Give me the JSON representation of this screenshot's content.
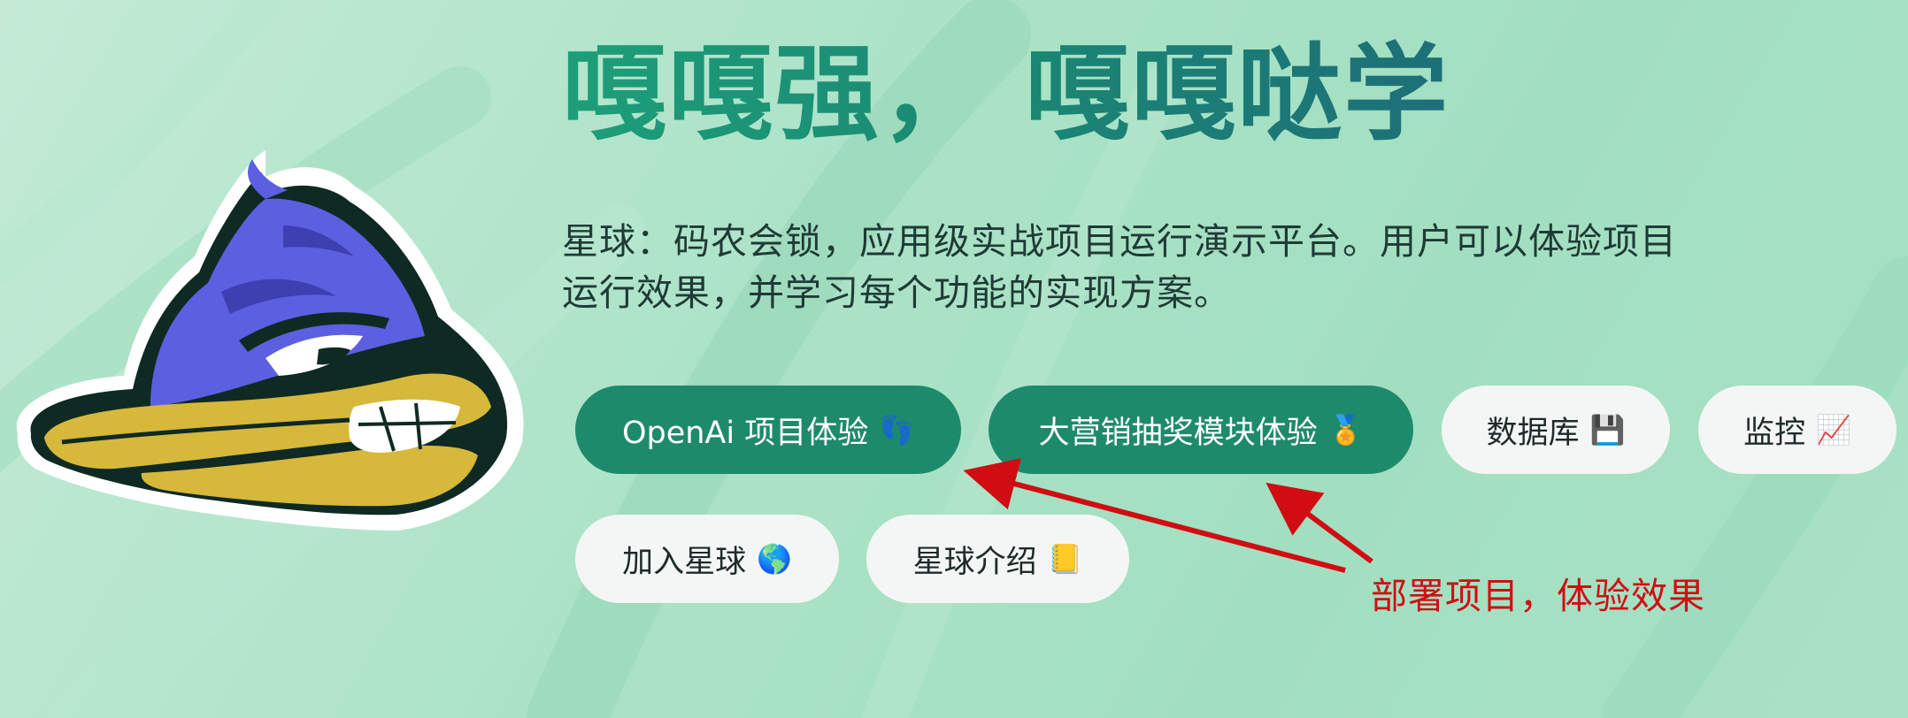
{
  "hero": {
    "title": "嘎嘎强， 嘎嘎哒学",
    "description": "星球：码农会锁，应用级实战项目运行演示平台。用户可以体验项目运行效果，并学习每个功能的实现方案。"
  },
  "buttons": [
    {
      "label": "OpenAi 项目体验",
      "icon": "👣",
      "icon_name": "footprints-icon",
      "style": "primary"
    },
    {
      "label": "大营销抽奖模块体验",
      "icon": "🏅",
      "icon_name": "medal-icon",
      "style": "primary"
    },
    {
      "label": "数据库",
      "icon": "💾",
      "icon_name": "floppy-disk-icon",
      "style": "light"
    },
    {
      "label": "监控",
      "icon": "📈",
      "icon_name": "chart-increasing-icon",
      "style": "light"
    },
    {
      "label": "加入星球",
      "icon": "🌎",
      "icon_name": "globe-icon",
      "style": "light"
    },
    {
      "label": "星球介绍",
      "icon": "📒",
      "icon_name": "ledger-icon",
      "style": "light"
    }
  ],
  "annotation": {
    "text": "部署项目，体验效果",
    "color": "#d00d12"
  },
  "colors": {
    "primary": "#1e8a6c",
    "light_button": "#f4f6f5",
    "background": "#ace3c8",
    "duck_head": "#5b5fe0",
    "duck_beak": "#d6b83a"
  }
}
